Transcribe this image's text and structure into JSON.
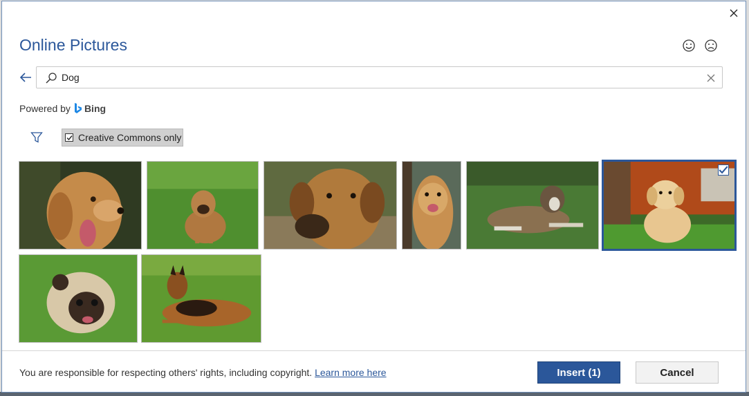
{
  "dialog": {
    "title": "Online Pictures"
  },
  "search": {
    "query": "Dog",
    "placeholder": ""
  },
  "powered_by": {
    "prefix": "Powered by",
    "brand": "Bing"
  },
  "filter": {
    "creative_commons_label": "Creative Commons only",
    "creative_commons_checked": true
  },
  "images": [
    {
      "subject": "golden retriever tongue out",
      "selected": false
    },
    {
      "subject": "puggle sitting on grass",
      "selected": false
    },
    {
      "subject": "brown dog close-up",
      "selected": false
    },
    {
      "subject": "golden retriever portrait",
      "selected": false
    },
    {
      "subject": "shepherd lying on grass",
      "selected": false
    },
    {
      "subject": "golden retriever puppy",
      "selected": true
    },
    {
      "subject": "pug on grass",
      "selected": false
    },
    {
      "subject": "german shepherd lying on grass",
      "selected": false
    }
  ],
  "footer": {
    "notice": "You are responsible for respecting others' rights, including copyright.",
    "link": "Learn more here",
    "insert_label": "Insert (1)",
    "cancel_label": "Cancel"
  },
  "colors": {
    "accent": "#2b579a",
    "title": "#2b579a"
  }
}
